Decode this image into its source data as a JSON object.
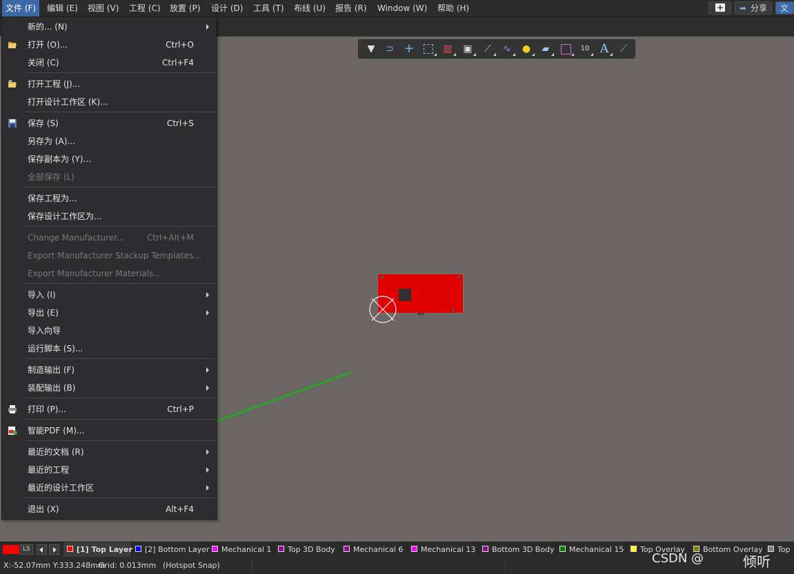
{
  "menubar": {
    "items": [
      "文件 (F)",
      "编辑 (E)",
      "视图 (V)",
      "工程 (C)",
      "放置 (P)",
      "设计 (D)",
      "工具 (T)",
      "布线 (U)",
      "报告 (R)",
      "Window (W)",
      "帮助 (H)"
    ],
    "share_label": "分享",
    "extra_label": "文"
  },
  "file_menu": {
    "items": [
      {
        "label": "新的... (N)",
        "shortcut": "",
        "submenu": true,
        "disabled": false,
        "icon": ""
      },
      {
        "label": "打开 (O)...",
        "shortcut": "Ctrl+O",
        "submenu": false,
        "disabled": false,
        "icon": "open-folder-icon"
      },
      {
        "label": "关闭 (C)",
        "shortcut": "Ctrl+F4",
        "submenu": false,
        "disabled": false,
        "icon": ""
      },
      {
        "label": "打开工程 (J)...",
        "shortcut": "",
        "submenu": false,
        "disabled": false,
        "icon": "open-project-icon"
      },
      {
        "label": "打开设计工作区 (K)...",
        "shortcut": "",
        "submenu": false,
        "disabled": false,
        "icon": ""
      },
      {
        "label": "保存 (S)",
        "shortcut": "Ctrl+S",
        "submenu": false,
        "disabled": false,
        "icon": "save-icon"
      },
      {
        "label": "另存为 (A)...",
        "shortcut": "",
        "submenu": false,
        "disabled": false,
        "icon": ""
      },
      {
        "label": "保存副本为 (Y)...",
        "shortcut": "",
        "submenu": false,
        "disabled": false,
        "icon": ""
      },
      {
        "label": "全部保存 (L)",
        "shortcut": "",
        "submenu": false,
        "disabled": true,
        "icon": ""
      },
      {
        "label": "保存工程为...",
        "shortcut": "",
        "submenu": false,
        "disabled": false,
        "icon": ""
      },
      {
        "label": "保存设计工作区为...",
        "shortcut": "",
        "submenu": false,
        "disabled": false,
        "icon": ""
      },
      {
        "label": "Change Manufacturer...",
        "shortcut": "Ctrl+Alt+M",
        "submenu": false,
        "disabled": true,
        "icon": ""
      },
      {
        "label": "Export Manufacturer Stackup Templates...",
        "shortcut": "",
        "submenu": false,
        "disabled": true,
        "icon": ""
      },
      {
        "label": "Export Manufacturer Materials...",
        "shortcut": "",
        "submenu": false,
        "disabled": true,
        "icon": ""
      },
      {
        "label": "导入 (I)",
        "shortcut": "",
        "submenu": true,
        "disabled": false,
        "icon": ""
      },
      {
        "label": "导出 (E)",
        "shortcut": "",
        "submenu": true,
        "disabled": false,
        "icon": ""
      },
      {
        "label": "导入向导",
        "shortcut": "",
        "submenu": false,
        "disabled": false,
        "icon": ""
      },
      {
        "label": "运行脚本 (S)...",
        "shortcut": "",
        "submenu": false,
        "disabled": false,
        "icon": ""
      },
      {
        "label": "制造输出 (F)",
        "shortcut": "",
        "submenu": true,
        "disabled": false,
        "icon": ""
      },
      {
        "label": "装配输出 (B)",
        "shortcut": "",
        "submenu": true,
        "disabled": false,
        "icon": ""
      },
      {
        "label": "打印 (P)...",
        "shortcut": "Ctrl+P",
        "submenu": false,
        "disabled": false,
        "icon": "print-icon"
      },
      {
        "label": "智能PDF (M)...",
        "shortcut": "",
        "submenu": false,
        "disabled": false,
        "icon": "smart-pdf-icon"
      },
      {
        "label": "最近的文档 (R)",
        "shortcut": "",
        "submenu": true,
        "disabled": false,
        "icon": ""
      },
      {
        "label": "最近的工程",
        "shortcut": "",
        "submenu": true,
        "disabled": false,
        "icon": ""
      },
      {
        "label": "最近的设计工作区",
        "shortcut": "",
        "submenu": true,
        "disabled": false,
        "icon": ""
      },
      {
        "label": "退出 (X)",
        "shortcut": "Alt+F4",
        "submenu": false,
        "disabled": false,
        "icon": ""
      }
    ]
  },
  "toolbar": {
    "icons": [
      "filter-icon",
      "route-icon",
      "crosshair-icon",
      "select-rect-icon",
      "align-icon",
      "component-icon",
      "interactive-route-icon",
      "diff-pair-icon",
      "pad-icon",
      "polygon-icon",
      "tune-length-icon",
      "dimension-icon",
      "text-icon",
      "line-icon"
    ]
  },
  "layers": {
    "current_color": "#ff0000",
    "ls_label": "LS",
    "tabs": [
      {
        "label": "[1] Top Layer",
        "color": "#ff0000",
        "active": true
      },
      {
        "label": "[2] Bottom Layer",
        "color": "#0000ff",
        "active": false
      },
      {
        "label": "Mechanical 1",
        "color": "#ff00ff",
        "active": false
      },
      {
        "label": "Top 3D Body",
        "color": "#990099",
        "active": false
      },
      {
        "label": "Mechanical 6",
        "color": "#990099",
        "active": false
      },
      {
        "label": "Mechanical 13",
        "color": "#ff00ff",
        "active": false
      },
      {
        "label": "Bottom 3D Body",
        "color": "#990099",
        "active": false
      },
      {
        "label": "Mechanical 15",
        "color": "#008000",
        "active": false
      },
      {
        "label": "Top Overlay",
        "color": "#ffff00",
        "active": false
      },
      {
        "label": "Bottom Overlay",
        "color": "#808000",
        "active": false
      },
      {
        "label": "Top",
        "color": "#808080",
        "active": false
      }
    ]
  },
  "status": {
    "coords": "X:-52.07mm Y:333.248mm",
    "grid": "Grid: 0.013mm",
    "snap": "(Hotspot Snap)"
  },
  "watermark": {
    "left": "CSDN @",
    "right": "倾听"
  }
}
